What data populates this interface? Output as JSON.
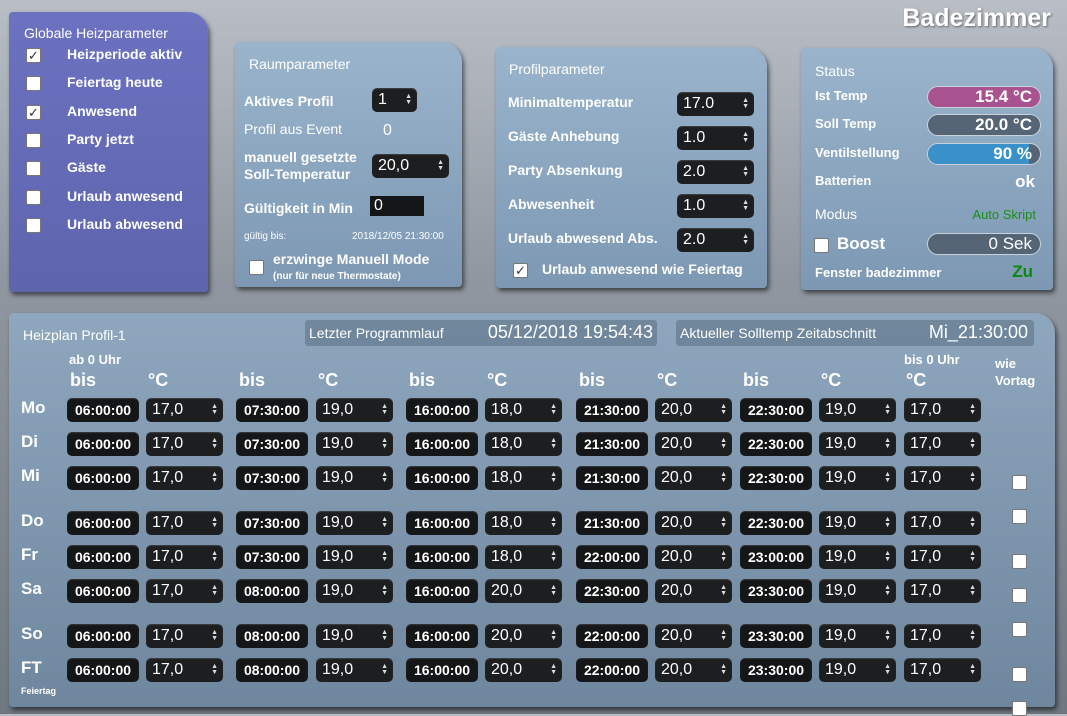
{
  "page_title": "Badezimmer",
  "global": {
    "title": "Globale Heizparameter",
    "items": [
      {
        "label": "Heizperiode aktiv",
        "checked": true
      },
      {
        "label": "Feiertag heute",
        "checked": false
      },
      {
        "label": "Anwesend",
        "checked": true
      },
      {
        "label": "Party jetzt",
        "checked": false
      },
      {
        "label": "Gäste",
        "checked": false
      },
      {
        "label": "Urlaub anwesend",
        "checked": false
      },
      {
        "label": "Urlaub abwesend",
        "checked": false
      }
    ]
  },
  "raum": {
    "title": "Raumparameter",
    "aktives_profil_label": "Aktives Profil",
    "aktives_profil": "1",
    "profil_event_label": "Profil aus Event",
    "profil_event": "0",
    "manuell_label1": "manuell gesetzte",
    "manuell_label2": "Soll-Temperatur",
    "manuell_value": "20,0",
    "gueltig_label": "Gültigkeit in Min",
    "gueltig_value": "0",
    "gueltig_bis_label": "gültig bis:",
    "gueltig_bis": "2018/12/05 21:30:00",
    "erzwinge_label": "erzwinge Manuell Mode",
    "erzwinge_sub": "(nur für neue Thermostate)"
  },
  "profil": {
    "title": "Profilparameter",
    "rows": [
      {
        "label": "Minimaltemperatur",
        "value": "17.0"
      },
      {
        "label": "Gäste Anhebung",
        "value": "1.0"
      },
      {
        "label": "Party Absenkung",
        "value": "2.0"
      },
      {
        "label": "Abwesenheit",
        "value": "1.0"
      },
      {
        "label": "Urlaub abwesend Abs.",
        "value": "2.0"
      }
    ],
    "urlaub_feiertag_label": "Urlaub anwesend wie Feiertag"
  },
  "status": {
    "title": "Status",
    "ist_label": "Ist Temp",
    "ist": "15.4 °C",
    "soll_label": "Soll Temp",
    "soll": "20.0 °C",
    "ventil_label": "Ventilstellung",
    "ventil": "90 %",
    "ventil_fraction": 0.9,
    "batterien_label": "Batterien",
    "batterien": "ok",
    "modus_label": "Modus",
    "modus": "Auto Skript",
    "boost_label": "Boost",
    "boost": "0 Sek",
    "fenster_label": "Fenster badezimmer",
    "fenster": "Zu",
    "colors": {
      "ist": "#a8538f",
      "ventil": "#3a90c8",
      "modus": "#1b8f1b",
      "fenster": "#0a8a0a"
    }
  },
  "plan": {
    "title": "Heizplan Profil-1",
    "letzter_label": "Letzter Programmlauf",
    "letzter": "05/12/2018 19:54:43",
    "abschnitt_label": "Aktueller Solltemp Zeitabschnitt",
    "abschnitt": "Mi_21:30:00",
    "h_ab": "ab 0 Uhr",
    "h_bis0": "bis 0 Uhr",
    "h_bis": "bis",
    "h_c": "°C",
    "h_wie": "wie",
    "h_vortag": "Vortag",
    "feiertag_note": "Feiertag",
    "days": [
      {
        "day": "Mo",
        "times": [
          "06:00:00",
          "07:30:00",
          "16:00:00",
          "21:30:00",
          "22:30:00"
        ],
        "temps": [
          "17,0",
          "19,0",
          "18,0",
          "20,0",
          "19,0",
          "17,0"
        ],
        "vortag": null
      },
      {
        "day": "Di",
        "times": [
          "06:00:00",
          "07:30:00",
          "16:00:00",
          "21:30:00",
          "22:30:00"
        ],
        "temps": [
          "17,0",
          "19,0",
          "18,0",
          "20,0",
          "19,0",
          "17,0"
        ],
        "vortag": false
      },
      {
        "day": "Mi",
        "times": [
          "06:00:00",
          "07:30:00",
          "16:00:00",
          "21:30:00",
          "22:30:00"
        ],
        "temps": [
          "17,0",
          "19,0",
          "18,0",
          "20,0",
          "19,0",
          "17,0"
        ],
        "vortag": false
      },
      {
        "day": "Do",
        "times": [
          "06:00:00",
          "07:30:00",
          "16:00:00",
          "21:30:00",
          "22:30:00"
        ],
        "temps": [
          "17,0",
          "19,0",
          "18,0",
          "20,0",
          "19,0",
          "17,0"
        ],
        "vortag": false
      },
      {
        "day": "Fr",
        "times": [
          "06:00:00",
          "07:30:00",
          "16:00:00",
          "22:00:00",
          "23:00:00"
        ],
        "temps": [
          "17,0",
          "19,0",
          "18,0",
          "20,0",
          "19,0",
          "17,0"
        ],
        "vortag": false
      },
      {
        "day": "Sa",
        "times": [
          "06:00:00",
          "08:00:00",
          "16:00:00",
          "22:30:00",
          "23:30:00"
        ],
        "temps": [
          "17,0",
          "19,0",
          "20,0",
          "20,0",
          "19,0",
          "17,0"
        ],
        "vortag": false
      },
      {
        "day": "So",
        "times": [
          "06:00:00",
          "08:00:00",
          "16:00:00",
          "22:00:00",
          "23:30:00"
        ],
        "temps": [
          "17,0",
          "19,0",
          "20,0",
          "20,0",
          "19,0",
          "17,0"
        ],
        "vortag": false
      },
      {
        "day": "FT",
        "times": [
          "06:00:00",
          "08:00:00",
          "16:00:00",
          "22:00:00",
          "23:30:00"
        ],
        "temps": [
          "17,0",
          "19,0",
          "20,0",
          "20,0",
          "19,0",
          "17,0"
        ],
        "vortag": false
      }
    ]
  }
}
